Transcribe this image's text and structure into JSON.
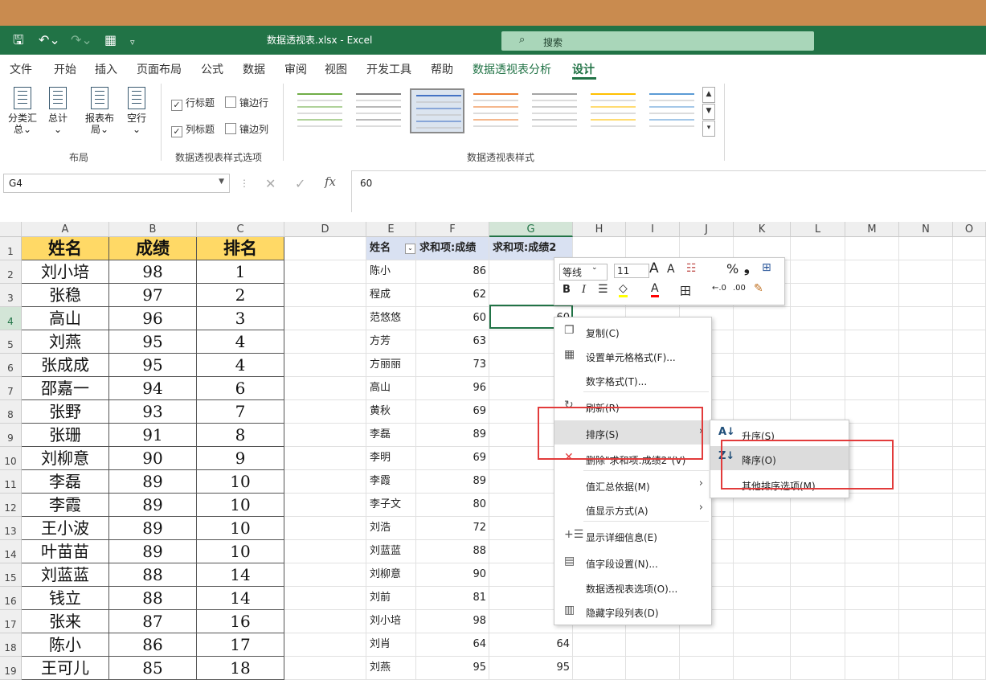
{
  "window": {
    "title": "数据透视表.xlsx  -  Excel",
    "search_label": "搜索"
  },
  "menu": {
    "items": [
      "文件",
      "开始",
      "插入",
      "页面布局",
      "公式",
      "数据",
      "审阅",
      "视图",
      "开发工具",
      "帮助"
    ],
    "pivot_analyze": "数据透视表分析",
    "design": "设计"
  },
  "ribbon": {
    "layout_buttons": [
      {
        "line1": "分类汇",
        "line2": "总⌄"
      },
      {
        "line1": "总计",
        "line2": "⌄"
      },
      {
        "line1": "报表布",
        "line2": "局⌄"
      },
      {
        "line1": "空行",
        "line2": "⌄"
      }
    ],
    "layout_group": "布局",
    "options": {
      "row_headers": "行标题",
      "col_headers": "列标题",
      "banded_rows": "镶边行",
      "banded_cols": "镶边列"
    },
    "options_group": "数据透视表样式选项",
    "styles_group": "数据透视表样式",
    "style_colors": [
      "#70ad47",
      "#7f7f7f",
      "#4472c4",
      "#ed7d31",
      "#a5a5a5",
      "#ffc000",
      "#5b9bd5"
    ]
  },
  "formula_bar": {
    "name_box": "G4",
    "value": "60"
  },
  "columns": [
    "A",
    "B",
    "C",
    "D",
    "E",
    "F",
    "G",
    "H",
    "I",
    "J",
    "K",
    "L",
    "M",
    "N",
    "O"
  ],
  "rows": [
    "1",
    "2",
    "3",
    "4",
    "5",
    "6",
    "7",
    "8",
    "9",
    "10",
    "11",
    "12",
    "13",
    "14",
    "15",
    "16",
    "17",
    "18",
    "19"
  ],
  "left_table": {
    "headers": [
      "姓名",
      "成绩",
      "排名"
    ],
    "rows": [
      [
        "刘小培",
        "98",
        "1"
      ],
      [
        "张稳",
        "97",
        "2"
      ],
      [
        "高山",
        "96",
        "3"
      ],
      [
        "刘燕",
        "95",
        "4"
      ],
      [
        "张成成",
        "95",
        "4"
      ],
      [
        "邵嘉一",
        "94",
        "6"
      ],
      [
        "张野",
        "93",
        "7"
      ],
      [
        "张珊",
        "91",
        "8"
      ],
      [
        "刘柳意",
        "90",
        "9"
      ],
      [
        "李磊",
        "89",
        "10"
      ],
      [
        "李霞",
        "89",
        "10"
      ],
      [
        "王小波",
        "89",
        "10"
      ],
      [
        "叶苗苗",
        "89",
        "10"
      ],
      [
        "刘蓝蓝",
        "88",
        "14"
      ],
      [
        "钱立",
        "88",
        "14"
      ],
      [
        "张来",
        "87",
        "16"
      ],
      [
        "陈小",
        "86",
        "17"
      ],
      [
        "王可儿",
        "85",
        "18"
      ]
    ]
  },
  "pivot": {
    "headers": [
      "姓名",
      "求和项:成绩",
      "求和项:成绩2"
    ],
    "filter_glyph": "⌄",
    "rows": [
      [
        "陈小",
        "86",
        ""
      ],
      [
        "程成",
        "62",
        ""
      ],
      [
        "范悠悠",
        "60",
        "60"
      ],
      [
        "方芳",
        "63",
        ""
      ],
      [
        "方丽丽",
        "73",
        ""
      ],
      [
        "高山",
        "96",
        ""
      ],
      [
        "黄秋",
        "69",
        ""
      ],
      [
        "李磊",
        "89",
        ""
      ],
      [
        "李明",
        "69",
        ""
      ],
      [
        "李霞",
        "89",
        ""
      ],
      [
        "李子文",
        "80",
        ""
      ],
      [
        "刘浩",
        "72",
        ""
      ],
      [
        "刘蓝蓝",
        "88",
        ""
      ],
      [
        "刘柳意",
        "90",
        ""
      ],
      [
        "刘前",
        "81",
        ""
      ],
      [
        "刘小培",
        "98",
        ""
      ],
      [
        "刘肖",
        "64",
        "64"
      ],
      [
        "刘燕",
        "95",
        "95"
      ]
    ]
  },
  "mini_toolbar": {
    "font": "等线",
    "size": "11",
    "grow": "A",
    "shrink": "A",
    "format_glyph": "☷",
    "percent": "%",
    "comma": "❟",
    "bold": "B",
    "italic": "I",
    "align": "☰",
    "fill": "◇",
    "font_color": "A",
    "border": "田",
    "inc_dec": "←.0",
    "dec_dec": ".00",
    "brush": "✎"
  },
  "context_menu": {
    "items": [
      {
        "label": "复制(C)",
        "icon": "❐"
      },
      {
        "label": "设置单元格格式(F)...",
        "icon": "▦"
      },
      {
        "label": "数字格式(T)...",
        "icon": ""
      },
      {
        "label": "刷新(R)",
        "icon": "↻"
      },
      {
        "label": "排序(S)",
        "icon": "",
        "arrow": "›"
      },
      {
        "label": "删除\"求和项:成绩2\"(V)",
        "icon": "✕"
      },
      {
        "label": "值汇总依据(M)",
        "icon": "",
        "arrow": "›"
      },
      {
        "label": "值显示方式(A)",
        "icon": "",
        "arrow": "›"
      },
      {
        "label": "显示详细信息(E)",
        "icon": "+☰"
      },
      {
        "label": "值字段设置(N)...",
        "icon": "▤"
      },
      {
        "label": "数据透视表选项(O)...",
        "icon": ""
      },
      {
        "label": "隐藏字段列表(D)",
        "icon": "▥"
      }
    ]
  },
  "sort_submenu": {
    "items": [
      {
        "label": "升序(S)",
        "icon": "A↓"
      },
      {
        "label": "降序(O)",
        "icon": "Z↓"
      },
      {
        "label": "其他排序选项(M)...",
        "icon": ""
      }
    ]
  }
}
